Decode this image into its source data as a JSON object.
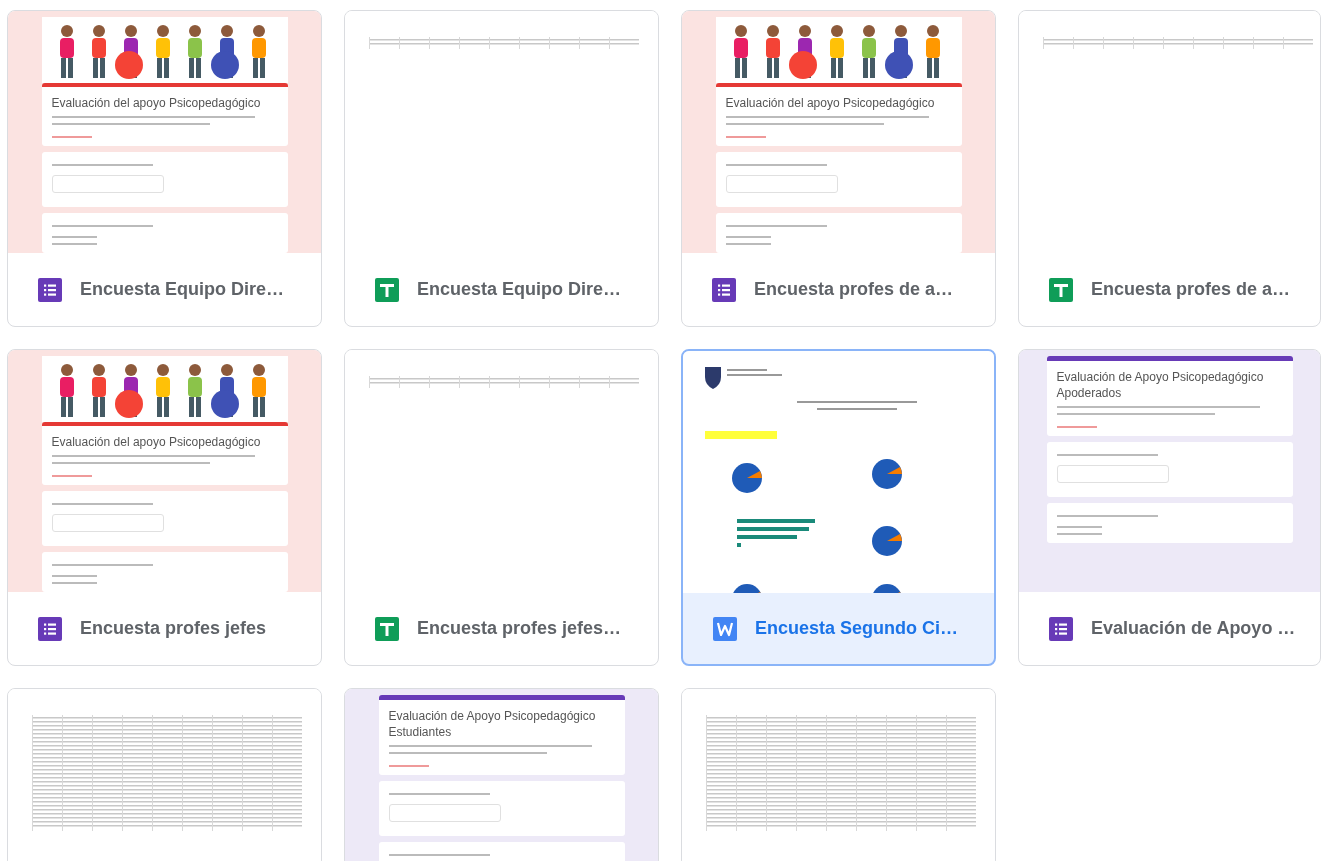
{
  "files": [
    {
      "kind": "form",
      "name": "Encuesta Equipo Dire…",
      "selected": false,
      "preview": {
        "banner": true,
        "title": "Evaluación del apoyo Psicopedagógico"
      }
    },
    {
      "kind": "sheet",
      "name": "Encuesta Equipo Dire…",
      "selected": false,
      "preview": {
        "dense": false
      }
    },
    {
      "kind": "form",
      "name": "Encuesta profes de a…",
      "selected": false,
      "preview": {
        "banner": true,
        "title": "Evaluación del apoyo Psicopedagógico"
      }
    },
    {
      "kind": "sheet",
      "name": "Encuesta profes de a…",
      "selected": false,
      "preview": {
        "dense": false
      }
    },
    {
      "kind": "form",
      "name": "Encuesta profes jefes",
      "selected": false,
      "preview": {
        "banner": true,
        "title": "Evaluación del apoyo Psicopedagógico"
      }
    },
    {
      "kind": "sheet",
      "name": "Encuesta profes jefes…",
      "selected": false,
      "preview": {
        "dense": false
      }
    },
    {
      "kind": "doc",
      "name": "Encuesta Segundo Ci…",
      "selected": true
    },
    {
      "kind": "form",
      "name": "Evaluación de Apoyo …",
      "selected": false,
      "preview": {
        "banner": false,
        "title": "Evaluación de Apoyo Psicopedagógico Apoderados"
      }
    },
    {
      "kind": "sheet",
      "selected": false,
      "preview": {
        "dense": true
      }
    },
    {
      "kind": "form",
      "selected": false,
      "preview": {
        "banner": false,
        "title": "Evaluación de Apoyo Psicopedagógico Estudiantes"
      }
    },
    {
      "kind": "sheet",
      "selected": false,
      "preview": {
        "dense": true
      }
    }
  ]
}
